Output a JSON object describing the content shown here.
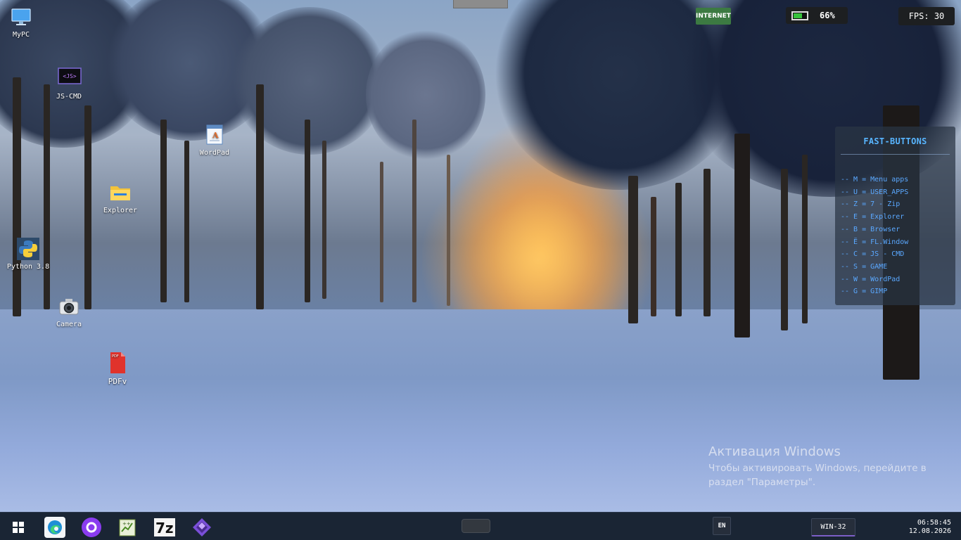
{
  "desktop_icons": [
    {
      "name": "mypc-icon",
      "label": "MyPC"
    },
    {
      "name": "js-cmd-icon",
      "label": "JS-CMD"
    },
    {
      "name": "wordpad-icon",
      "label": "WordPad"
    },
    {
      "name": "explorer-icon",
      "label": "Explorer"
    },
    {
      "name": "python-icon",
      "label": "Python 3.8"
    },
    {
      "name": "camera-icon",
      "label": "Camera"
    },
    {
      "name": "pdfv-icon",
      "label": "PDFv"
    }
  ],
  "status": {
    "internet_label": "INTERNET",
    "battery_percent": "66%",
    "battery_level": 0.66,
    "fps_label": "FPS: 30"
  },
  "fast_buttons": {
    "title": "FAST-BUTTONS",
    "items": [
      "-- M = Menu apps",
      "-- U = USER_APPS",
      "-- Z = 7 - Zip",
      "-- E = Explorer",
      "-- B = Browser",
      "-- Ë = FL.Window",
      "-- C = JS - CMD",
      "-- S = GAME",
      "-- W = WordPad",
      "-- G = GIMP"
    ]
  },
  "watermark": {
    "heading": "Активация Windows",
    "line1": "Чтобы активировать Windows, перейдите в",
    "line2": "раздел \"Параметры\"."
  },
  "taskbar": {
    "apps": [
      "windows-start-icon",
      "edge-icon",
      "alice-icon",
      "notepad-plus-icon",
      "7zip-icon",
      "game-icon"
    ],
    "lang": "EN",
    "window_button": "WIN-32",
    "time": "06:58:45",
    "date": "12.08.2026"
  },
  "colors": {
    "accent_blue": "#5aa8ff",
    "internet_green": "#3c7a42",
    "battery_green": "#37c23c",
    "taskbar_bg": "#1a2534"
  }
}
